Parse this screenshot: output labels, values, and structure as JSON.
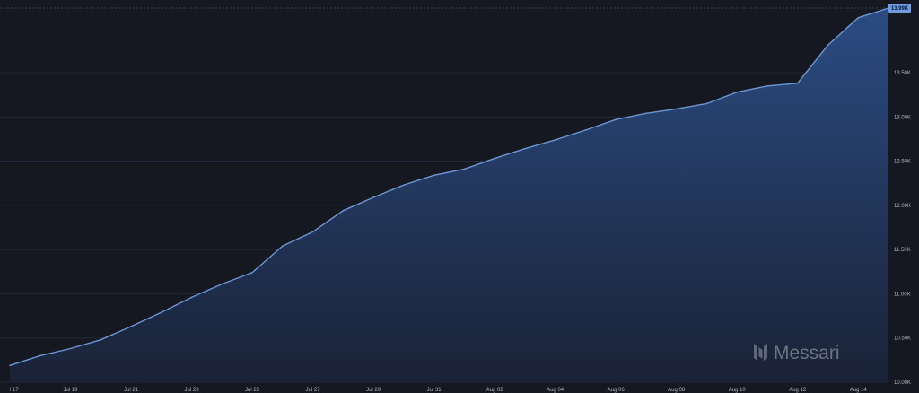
{
  "chart_data": {
    "type": "area",
    "x": [
      "Jul 17",
      "Jul 18",
      "Jul 19",
      "Jul 20",
      "Jul 21",
      "Jul 22",
      "Jul 23",
      "Jul 24",
      "Jul 25",
      "Jul 26",
      "Jul 27",
      "Jul 28",
      "Jul 29",
      "Jul 30",
      "Jul 31",
      "Aug 01",
      "Aug 02",
      "Aug 03",
      "Aug 04",
      "Aug 05",
      "Aug 06",
      "Aug 07",
      "Aug 08",
      "Aug 09",
      "Aug 10",
      "Aug 11",
      "Aug 12",
      "Aug 13",
      "Aug 14",
      "Aug 15"
    ],
    "values": [
      10190,
      10300,
      10380,
      10480,
      10630,
      10790,
      10960,
      11110,
      11240,
      11540,
      11700,
      11940,
      12090,
      12230,
      12340,
      12410,
      12530,
      12640,
      12740,
      12850,
      12970,
      13040,
      13090,
      13150,
      13280,
      13350,
      13380,
      13810,
      14120,
      14230
    ],
    "x_tick_labels": [
      "l 17",
      "Jul 19",
      "Jul 21",
      "Jul 23",
      "Jul 25",
      "Jul 27",
      "Jul 29",
      "Jul 31",
      "Aug 02",
      "Aug 04",
      "Aug 06",
      "Aug 08",
      "Aug 10",
      "Aug 12",
      "Aug 14"
    ],
    "y_ticks": [
      10000,
      10500,
      11000,
      11500,
      12000,
      12500,
      13000,
      13500
    ],
    "y_tick_labels": [
      "10.00K",
      "10.50K",
      "11.00K",
      "11.50K",
      "12.00K",
      "12.50K",
      "13.00K",
      "13.50K"
    ],
    "ylim": [
      10000,
      14230
    ],
    "last_value_label": "13.99K",
    "grid": true,
    "legend": "none",
    "title": "",
    "xlabel": "",
    "ylabel": "",
    "colors": {
      "background": "#151820",
      "line": "#6b96d6",
      "fill_top": "#2b4c82",
      "fill_bottom": "#1a2236",
      "grid": "#222838",
      "tick_text": "#aeb4c0",
      "badge": "#6f9be0"
    }
  },
  "watermark": {
    "text": "Messari",
    "icon": "messari-logo-icon"
  }
}
